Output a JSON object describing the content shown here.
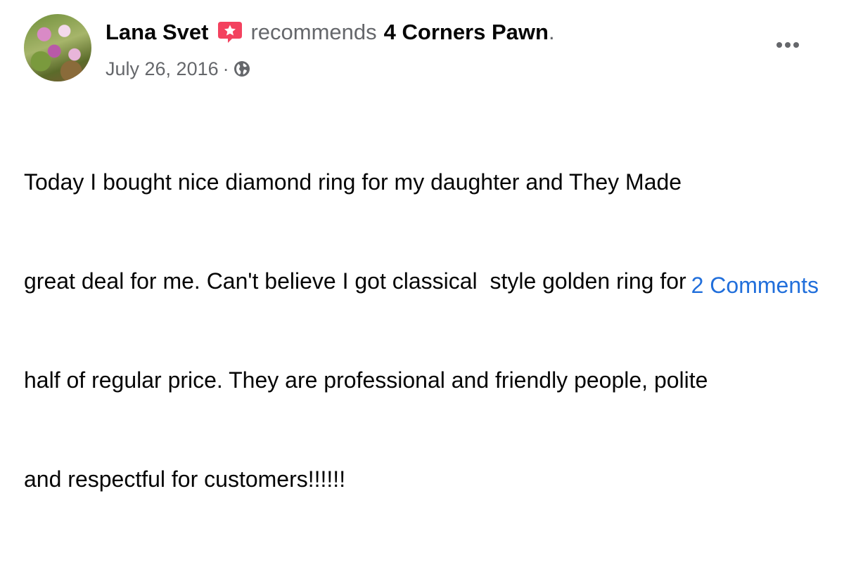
{
  "post": {
    "author": "Lana Svet",
    "verb": "recommends",
    "page_name": "4 Corners Pawn",
    "period": ".",
    "date": "July 26, 2016",
    "separator": "·",
    "privacy_icon": "globe-icon",
    "recommend_icon": "recommend-star-badge-icon",
    "body_lines": [
      "Today I bought nice diamond ring for my daughter and They Made",
      "great deal for me. Can't believe I got classical  style golden ring for",
      "half of regular price. They are professional and friendly people, polite",
      "and respectful for customers!!!!!!"
    ],
    "comments_label": "2 Comments"
  },
  "colors": {
    "primary_text": "#050505",
    "secondary_text": "#65676b",
    "link_blue": "#216fdb",
    "recommend_badge": "#f3425f"
  }
}
